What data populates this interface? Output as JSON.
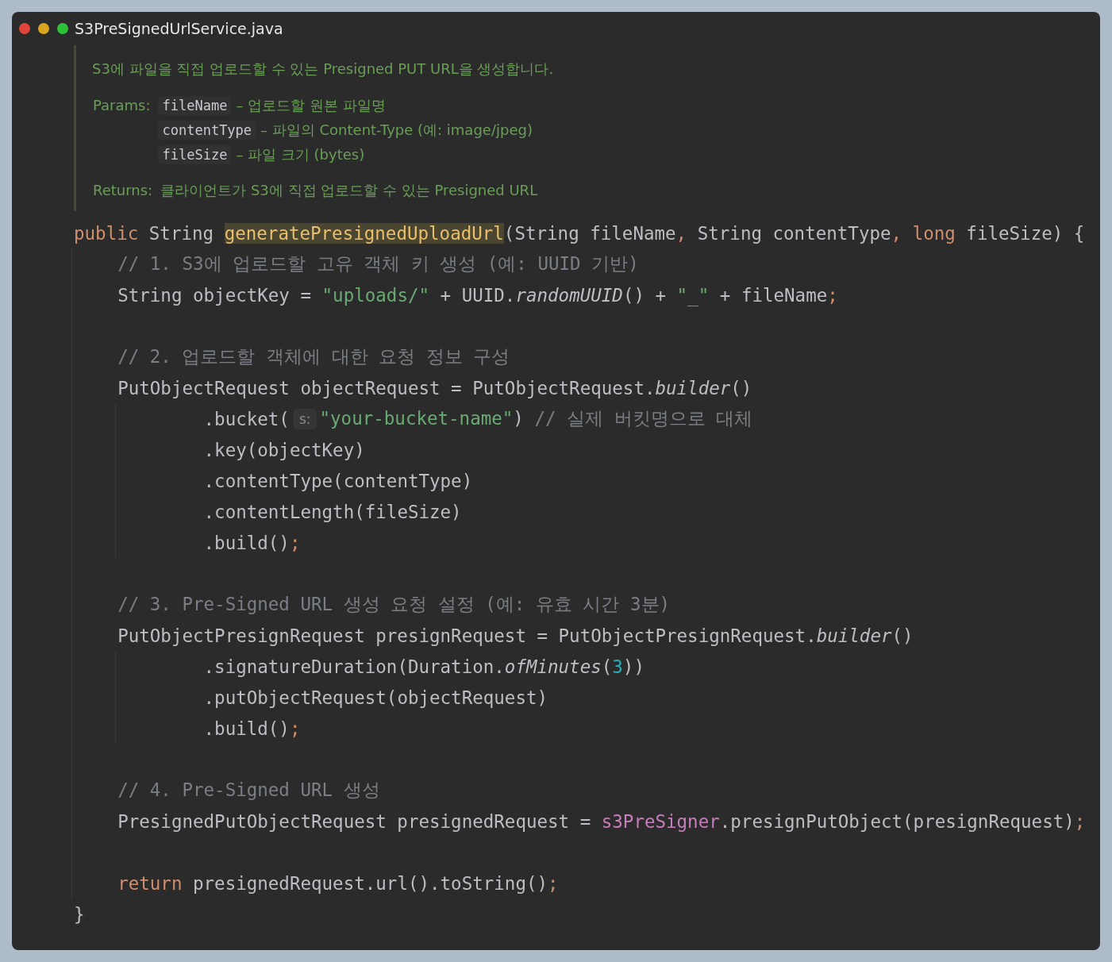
{
  "window": {
    "title": "S3PreSignedUrlService.java"
  },
  "doc": {
    "description": "S3에 파일을 직접 업로드할 수 있는 Presigned PUT URL을 생성합니다.",
    "params_label": "Params:",
    "params": [
      {
        "name": "fileName",
        "description": "– 업로드할 원본 파일명"
      },
      {
        "name": "contentType",
        "description": "– 파일의 Content-Type (예: image/jpeg)"
      },
      {
        "name": "fileSize",
        "description": "– 파일 크기 (bytes)"
      }
    ],
    "returns_label": "Returns:",
    "returns": "클라이언트가 S3에 직접 업로드할 수 있는 Presigned URL"
  },
  "code": {
    "signature": [
      {
        "kind": "keyword",
        "text": "public"
      },
      {
        "kind": "plain",
        "text": " String "
      },
      {
        "kind": "highlight",
        "text": "generatePresignedUploadUrl"
      },
      {
        "kind": "plain",
        "text": "(String fileName"
      },
      {
        "kind": "punct",
        "text": ","
      },
      {
        "kind": "plain",
        "text": " String contentType"
      },
      {
        "kind": "punct",
        "text": ", "
      },
      {
        "kind": "keyword",
        "text": "long"
      },
      {
        "kind": "plain",
        "text": " fileSize) {"
      }
    ],
    "body": [
      {
        "tokens": [
          {
            "kind": "comment",
            "text": "// 1. S3에 업로드할 고유 객체 키 생성 (예: UUID 기반)"
          }
        ]
      },
      {
        "tokens": [
          {
            "kind": "plain",
            "text": "String objectKey = "
          },
          {
            "kind": "string",
            "text": "\"uploads/\""
          },
          {
            "kind": "plain",
            "text": " + UUID."
          },
          {
            "kind": "italic",
            "text": "randomUUID"
          },
          {
            "kind": "plain",
            "text": "() + "
          },
          {
            "kind": "string",
            "text": "\"_\""
          },
          {
            "kind": "plain",
            "text": " + fileName"
          },
          {
            "kind": "punct",
            "text": ";"
          }
        ]
      },
      {
        "kind": "blank"
      },
      {
        "tokens": [
          {
            "kind": "comment",
            "text": "// 2. 업로드할 객체에 대한 요청 정보 구성"
          }
        ]
      },
      {
        "tokens": [
          {
            "kind": "plain",
            "text": "PutObjectRequest objectRequest = PutObjectRequest."
          },
          {
            "kind": "italic",
            "text": "builder"
          },
          {
            "kind": "plain",
            "text": "()"
          }
        ],
        "children": [
          {
            "tokens": [
              {
                "kind": "plain",
                "text": ".bucket("
              },
              {
                "kind": "hint",
                "text": "s:"
              },
              {
                "kind": "string",
                "text": "\"your-bucket-name\""
              },
              {
                "kind": "plain",
                "text": ") "
              },
              {
                "kind": "comment",
                "text": "// 실제 버킷명으로 대체"
              }
            ]
          },
          {
            "tokens": [
              {
                "kind": "plain",
                "text": ".key(objectKey)"
              }
            ]
          },
          {
            "tokens": [
              {
                "kind": "plain",
                "text": ".contentType(contentType)"
              }
            ]
          },
          {
            "tokens": [
              {
                "kind": "plain",
                "text": ".contentLength(fileSize)"
              }
            ]
          },
          {
            "tokens": [
              {
                "kind": "plain",
                "text": ".build()"
              },
              {
                "kind": "punct",
                "text": ";"
              }
            ]
          }
        ]
      },
      {
        "kind": "blank"
      },
      {
        "tokens": [
          {
            "kind": "comment",
            "text": "// 3. Pre-Signed URL 생성 요청 설정 (예: 유효 시간 3분)"
          }
        ]
      },
      {
        "tokens": [
          {
            "kind": "plain",
            "text": "PutObjectPresignRequest presignRequest = PutObjectPresignRequest."
          },
          {
            "kind": "italic",
            "text": "builder"
          },
          {
            "kind": "plain",
            "text": "()"
          }
        ],
        "children": [
          {
            "tokens": [
              {
                "kind": "plain",
                "text": ".signatureDuration(Duration."
              },
              {
                "kind": "italic",
                "text": "ofMinutes"
              },
              {
                "kind": "plain",
                "text": "("
              },
              {
                "kind": "number",
                "text": "3"
              },
              {
                "kind": "plain",
                "text": "))"
              }
            ]
          },
          {
            "tokens": [
              {
                "kind": "plain",
                "text": ".putObjectRequest(objectRequest)"
              }
            ]
          },
          {
            "tokens": [
              {
                "kind": "plain",
                "text": ".build()"
              },
              {
                "kind": "punct",
                "text": ";"
              }
            ]
          }
        ]
      },
      {
        "kind": "blank"
      },
      {
        "tokens": [
          {
            "kind": "comment",
            "text": "// 4. Pre-Signed URL 생성"
          }
        ]
      },
      {
        "tokens": [
          {
            "kind": "plain",
            "text": "PresignedPutObjectRequest presignedRequest = "
          },
          {
            "kind": "field",
            "text": "s3PreSigner"
          },
          {
            "kind": "plain",
            "text": ".presignPutObject(presignRequest)"
          },
          {
            "kind": "punct",
            "text": ";"
          }
        ]
      },
      {
        "kind": "blank"
      },
      {
        "tokens": [
          {
            "kind": "keyword",
            "text": "return"
          },
          {
            "kind": "plain",
            "text": " presignedRequest.url().toString()"
          },
          {
            "kind": "punct",
            "text": ";"
          }
        ]
      }
    ],
    "closing": "}"
  }
}
